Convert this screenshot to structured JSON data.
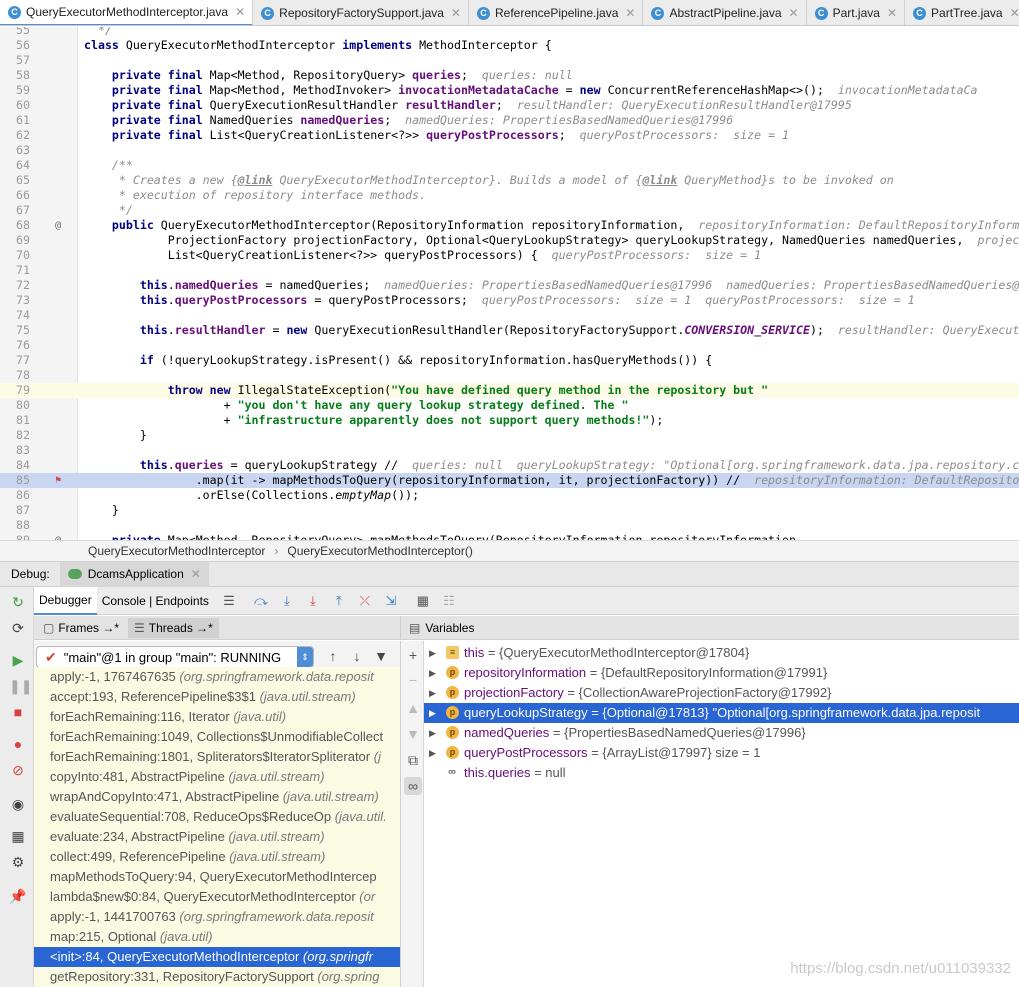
{
  "tabs": [
    {
      "label": "QueryExecutorMethodInterceptor.java",
      "active": true
    },
    {
      "label": "RepositoryFactorySupport.java",
      "active": false
    },
    {
      "label": "ReferencePipeline.java",
      "active": false
    },
    {
      "label": "AbstractPipeline.java",
      "active": false
    },
    {
      "label": "Part.java",
      "active": false
    },
    {
      "label": "PartTree.java",
      "active": false
    }
  ],
  "code_lines": [
    {
      "n": "55",
      "t": "  */"
    },
    {
      "n": "56",
      "t": "class QueryExecutorMethodInterceptor implements MethodInterceptor {"
    },
    {
      "n": "57",
      "t": ""
    },
    {
      "n": "58",
      "t": "    private final Map<Method, RepositoryQuery> queries;",
      "hint": "queries: null"
    },
    {
      "n": "59",
      "t": "    private final Map<Method, MethodInvoker> invocationMetadataCache = new ConcurrentReferenceHashMap<>();",
      "hint": "invocationMetadataCa"
    },
    {
      "n": "60",
      "t": "    private final QueryExecutionResultHandler resultHandler;",
      "hint": "resultHandler: QueryExecutionResultHandler@17995"
    },
    {
      "n": "61",
      "t": "    private final NamedQueries namedQueries;",
      "hint": "namedQueries: PropertiesBasedNamedQueries@17996"
    },
    {
      "n": "62",
      "t": "    private final List<QueryCreationListener<?>> queryPostProcessors;",
      "hint": "queryPostProcessors:  size = 1"
    },
    {
      "n": "63",
      "t": ""
    },
    {
      "n": "64",
      "t": "    /**"
    },
    {
      "n": "65",
      "t": "     * Creates a new {@link QueryExecutorMethodInterceptor}. Builds a model of {@link QueryMethod}s to be invoked on"
    },
    {
      "n": "66",
      "t": "     * execution of repository interface methods."
    },
    {
      "n": "67",
      "t": "     */"
    },
    {
      "n": "68",
      "t": "    public QueryExecutorMethodInterceptor(RepositoryInformation repositoryInformation,",
      "hint": "repositoryInformation: DefaultRepositoryInform"
    },
    {
      "n": "69",
      "t": "            ProjectionFactory projectionFactory, Optional<QueryLookupStrategy> queryLookupStrategy, NamedQueries namedQueries,",
      "hint": "projec"
    },
    {
      "n": "70",
      "t": "            List<QueryCreationListener<?>> queryPostProcessors) {",
      "hint": "queryPostProcessors:  size = 1"
    },
    {
      "n": "71",
      "t": ""
    },
    {
      "n": "72",
      "t": "        this.namedQueries = namedQueries;",
      "hint": "namedQueries: PropertiesBasedNamedQueries@17996  namedQueries: PropertiesBasedNamedQueries@"
    },
    {
      "n": "73",
      "t": "        this.queryPostProcessors = queryPostProcessors;",
      "hint": "queryPostProcessors:  size = 1  queryPostProcessors:  size = 1"
    },
    {
      "n": "74",
      "t": ""
    },
    {
      "n": "75",
      "t": "        this.resultHandler = new QueryExecutionResultHandler(RepositoryFactorySupport.CONVERSION_SERVICE);",
      "hint": "resultHandler: QueryExecut"
    },
    {
      "n": "76",
      "t": ""
    },
    {
      "n": "77",
      "t": "        if (!queryLookupStrategy.isPresent() && repositoryInformation.hasQueryMethods()) {"
    },
    {
      "n": "78",
      "t": ""
    },
    {
      "n": "79",
      "t": "            throw new IllegalStateException(\"You have defined query method in the repository but \""
    },
    {
      "n": "80",
      "t": "                    + \"you don't have any query lookup strategy defined. The \""
    },
    {
      "n": "81",
      "t": "                    + \"infrastructure apparently does not support query methods!\");"
    },
    {
      "n": "82",
      "t": "        }"
    },
    {
      "n": "83",
      "t": ""
    },
    {
      "n": "84",
      "t": "        this.queries = queryLookupStrategy //",
      "hint": "queries: null  queryLookupStrategy: \"Optional[org.springframework.data.jpa.repository.c"
    },
    {
      "n": "85",
      "t": "                .map(it -> mapMethodsToQuery(repositoryInformation, it, projectionFactory)) //",
      "hint": "repositoryInformation: DefaultReposito"
    },
    {
      "n": "86",
      "t": "                .orElse(Collections.emptyMap());"
    },
    {
      "n": "87",
      "t": "    }"
    },
    {
      "n": "88",
      "t": ""
    },
    {
      "n": "89",
      "t": "    private Map<Method, RepositoryQuery> mapMethodsToQuery(RepositoryInformation repositoryInformation,"
    }
  ],
  "breadcrumb": [
    "QueryExecutorMethodInterceptor",
    "QueryExecutorMethodInterceptor()"
  ],
  "debug": {
    "label": "Debug:",
    "run_tab": "DcamsApplication",
    "tabs": [
      "Debugger",
      "Console | Endpoints"
    ],
    "frames_tab": "Frames →*",
    "threads_tab": "Threads →*",
    "variables_title": "Variables",
    "thread_selector": "\"main\"@1 in group \"main\": RUNNING"
  },
  "frames": [
    {
      "m": "apply:-1, 1767467635 ",
      "p": "(org.springframework.data.reposit"
    },
    {
      "m": "accept:193, ReferencePipeline$3$1 ",
      "p": "(java.util.stream)"
    },
    {
      "m": "forEachRemaining:116, Iterator ",
      "p": "(java.util)"
    },
    {
      "m": "forEachRemaining:1049, Collections$UnmodifiableCollect",
      "p": ""
    },
    {
      "m": "forEachRemaining:1801, Spliterators$IteratorSpliterator ",
      "p": "(j"
    },
    {
      "m": "copyInto:481, AbstractPipeline ",
      "p": "(java.util.stream)"
    },
    {
      "m": "wrapAndCopyInto:471, AbstractPipeline ",
      "p": "(java.util.stream)"
    },
    {
      "m": "evaluateSequential:708, ReduceOps$ReduceOp ",
      "p": "(java.util."
    },
    {
      "m": "evaluate:234, AbstractPipeline ",
      "p": "(java.util.stream)"
    },
    {
      "m": "collect:499, ReferencePipeline ",
      "p": "(java.util.stream)"
    },
    {
      "m": "mapMethodsToQuery:94, QueryExecutorMethodIntercep",
      "p": ""
    },
    {
      "m": "lambda$new$0:84, QueryExecutorMethodInterceptor ",
      "p": "(or"
    },
    {
      "m": "apply:-1, 1441700763 ",
      "p": "(org.springframework.data.reposit"
    },
    {
      "m": "map:215, Optional ",
      "p": "(java.util)"
    },
    {
      "m": "<init>:84, QueryExecutorMethodInterceptor ",
      "p": "(org.springfr",
      "sel": true
    },
    {
      "m": "getRepository:331, RepositoryFactorySupport ",
      "p": "(org.spring"
    }
  ],
  "variables": [
    {
      "icon": "this",
      "name": "this",
      "value": " = {QueryExecutorMethodInterceptor@17804}"
    },
    {
      "icon": "p",
      "name": "repositoryInformation",
      "value": " = {DefaultRepositoryInformation@17991}"
    },
    {
      "icon": "p",
      "name": "projectionFactory",
      "value": " = {CollectionAwareProjectionFactory@17992}"
    },
    {
      "icon": "p",
      "name": "queryLookupStrategy",
      "value": " = {Optional@17813} \"Optional[org.springframework.data.jpa.reposit",
      "sel": true
    },
    {
      "icon": "p",
      "name": "namedQueries",
      "value": " = {PropertiesBasedNamedQueries@17996}"
    },
    {
      "icon": "p",
      "name": "queryPostProcessors",
      "value": " = {ArrayList@17997}  size = 1"
    },
    {
      "icon": "watch",
      "name": "this.queries",
      "value": " = null"
    }
  ],
  "watermark": "https://blog.csdn.net/u011039332"
}
